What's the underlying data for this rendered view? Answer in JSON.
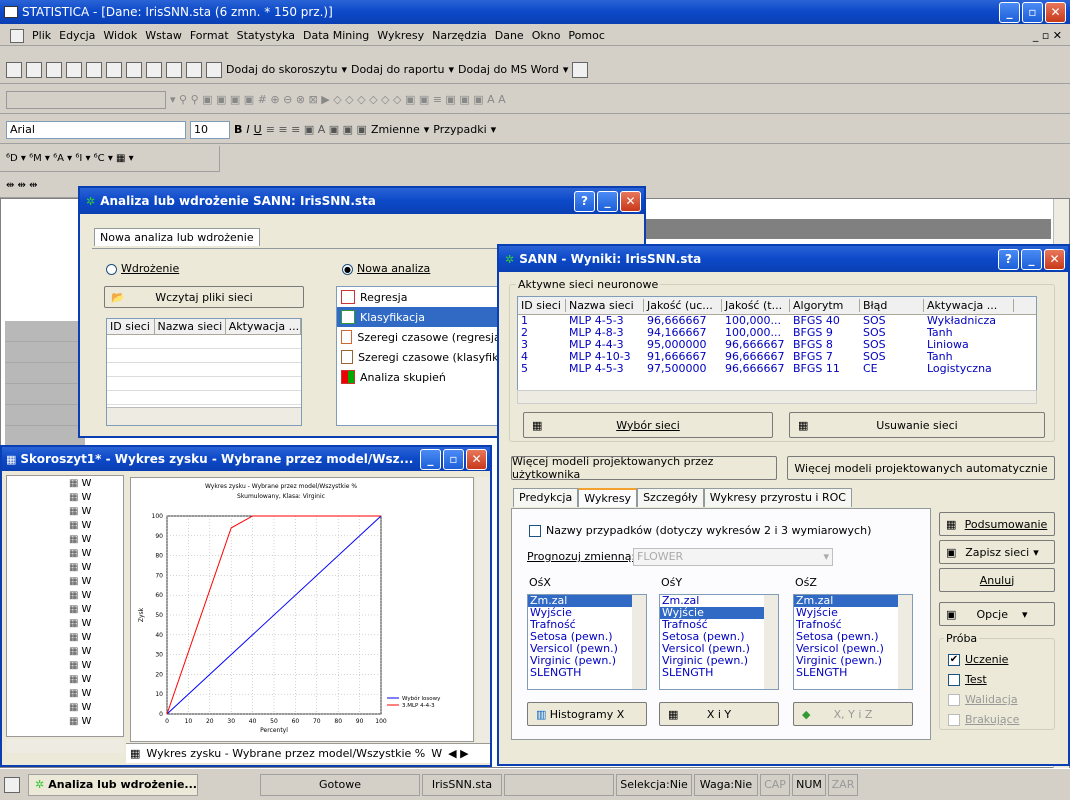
{
  "app": {
    "title": "STATISTICA - [Dane: IrisSNN.sta (6 zmn. * 150 prz.)]"
  },
  "menu": [
    "Plik",
    "Edycja",
    "Widok",
    "Wstaw",
    "Format",
    "Statystyka",
    "Data Mining",
    "Wykresy",
    "Narzędzia",
    "Dane",
    "Okno",
    "Pomoc"
  ],
  "toolbar1": {
    "add_workbook": "Dodaj do skoroszytu",
    "add_report": "Dodaj do raportu",
    "add_word": "Dodaj do MS Word"
  },
  "toolbar3": {
    "font": "Arial",
    "size": "10",
    "zmienne": "Zmienne",
    "przypadki": "Przypadki"
  },
  "dialog1": {
    "title": "Analiza lub wdrożenie SANN: IrisSNN.sta",
    "tab": "Nowa analiza lub wdrożenie",
    "radio_deploy": "Wdrożenie",
    "radio_new": "Nowa analiza",
    "load_button": "Wczytaj pliki sieci",
    "cols": [
      "ID sieci",
      "Nazwa sieci",
      "Aktywacja ..."
    ],
    "types": [
      "Regresja",
      "Klasyfikacja",
      "Szeregi czasowe (regresja)",
      "Szeregi czasowe (klasyfika",
      "Analiza skupień"
    ]
  },
  "workbook": {
    "title": "Skoroszyt1* - Wykres zysku - Wybrane przez model/Wsz...",
    "tree_item": "W",
    "tab_label": "Wykres zysku - Wybrane przez model/Wszystkie %",
    "tab2": "W"
  },
  "chart_data": {
    "type": "line",
    "title": "Wykres zysku - Wybrane przez model/Wszystkie %",
    "subtitle": "Skumulowany, Klasa: Virginic",
    "xlabel": "Percentyl",
    "ylabel": "Zysk",
    "xlim": [
      0,
      100
    ],
    "ylim": [
      0,
      100
    ],
    "xticks": [
      0,
      10,
      20,
      30,
      40,
      50,
      60,
      70,
      80,
      90,
      100
    ],
    "yticks": [
      0,
      10,
      20,
      30,
      40,
      50,
      60,
      70,
      80,
      90,
      100
    ],
    "series": [
      {
        "name": "Wybór losowy",
        "color": "#0000ff",
        "x": [
          0,
          100
        ],
        "y": [
          0,
          100
        ]
      },
      {
        "name": "3.MLP 4-4-3",
        "color": "#ff0000",
        "x": [
          0,
          30,
          40,
          100
        ],
        "y": [
          0,
          94,
          100,
          100
        ]
      }
    ]
  },
  "dialog2": {
    "title": "SANN - Wyniki: IrisSNN.sta",
    "group": "Aktywne sieci neuronowe",
    "cols": [
      "ID sieci",
      "Nazwa sieci",
      "Jakość (uc...",
      "Jakość (t...",
      "Algorytm",
      "Błąd",
      "Aktywacja ..."
    ],
    "rows": [
      [
        "1",
        "MLP 4-5-3",
        "96,666667",
        "100,000...",
        "BFGS 40",
        "SOS",
        "Wykładnicza"
      ],
      [
        "2",
        "MLP 4-8-3",
        "94,166667",
        "100,000...",
        "BFGS 9",
        "SOS",
        "Tanh"
      ],
      [
        "3",
        "MLP 4-4-3",
        "95,000000",
        "96,666667",
        "BFGS 8",
        "SOS",
        "Liniowa"
      ],
      [
        "4",
        "MLP 4-10-3",
        "91,666667",
        "96,666667",
        "BFGS 7",
        "SOS",
        "Tanh"
      ],
      [
        "5",
        "MLP 4-5-3",
        "97,500000",
        "96,666667",
        "BFGS 11",
        "CE",
        "Logistyczna"
      ]
    ],
    "select_btn": "Wybór sieci",
    "remove_btn": "Usuwanie sieci",
    "more_user": "Więcej modeli projektowanych przez użytkownika",
    "more_auto": "Więcej modeli projektowanych automatycznie",
    "tabs": [
      "Predykcja",
      "Wykresy",
      "Szczegóły",
      "Wykresy przyrostu i ROC"
    ],
    "case_names": "Nazwy przypadków (dotyczy wykresów 2 i 3 wymiarowych)",
    "predict_label": "Prognozuj zmienną:",
    "predict_value": "FLOWER",
    "axis_x": "OśX",
    "axis_y": "OśY",
    "axis_z": "OśZ",
    "items": [
      "Zm.zal",
      "Wyjście",
      "Trafność",
      "Setosa (pewn.)",
      "Versicol (pewn.)",
      "Virginic (pewn.)",
      "SLENGTH"
    ],
    "hist_btn": "Histogramy X",
    "xy_btn": "X i Y",
    "xyz_btn": "X, Y i Z",
    "summary": "Podsumowanie",
    "save": "Zapisz sieci",
    "cancel": "Anuluj",
    "options": "Opcje",
    "sample": "Próba",
    "s_train": "Uczenie",
    "s_test": "Test",
    "s_valid": "Walidacja",
    "s_missing": "Brakujące"
  },
  "status": {
    "task": "Analiza lub wdrożenie...",
    "ready": "Gotowe",
    "file": "IrisSNN.sta",
    "sel": "Selekcja:Nie",
    "weight": "Waga:Nie",
    "cap": "CAP",
    "num": "NUM",
    "zar": "ZAR"
  }
}
